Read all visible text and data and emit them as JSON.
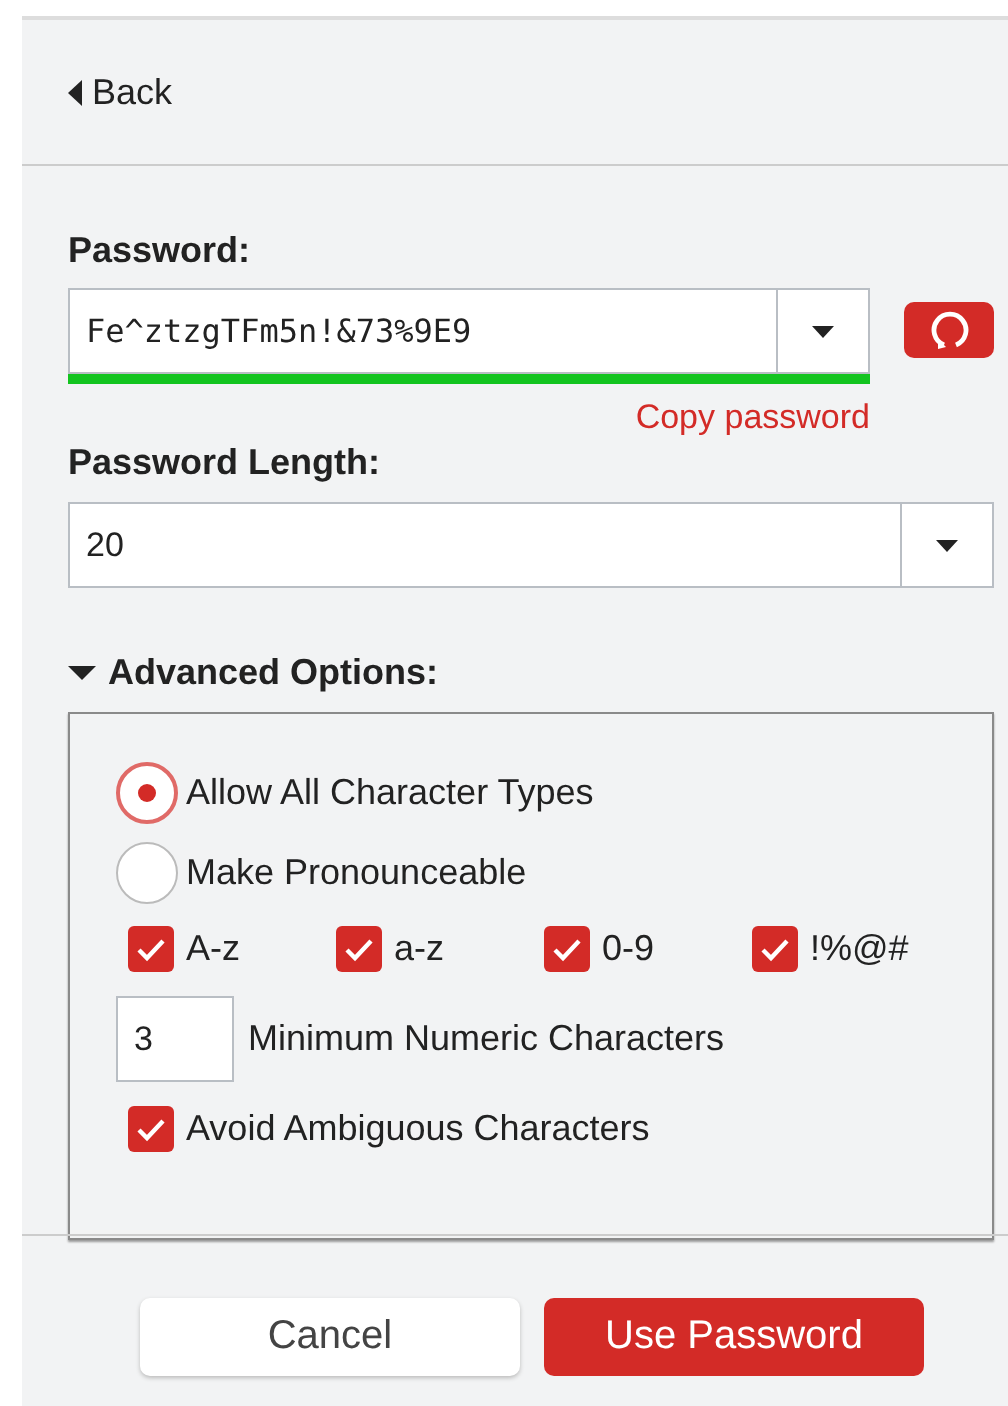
{
  "back": {
    "label": "Back"
  },
  "password": {
    "label": "Password:",
    "value": "Fe^ztzgTFm5n!&73%9E9",
    "strength": {
      "level": 1.0,
      "color": "#13c41f"
    },
    "copy_link": "Copy password"
  },
  "length": {
    "label": "Password Length:",
    "value": "20"
  },
  "advanced": {
    "label": "Advanced Options:",
    "expanded": true,
    "modes": [
      {
        "label": "Allow All Character Types",
        "selected": true
      },
      {
        "label": "Make Pronounceable",
        "selected": false
      }
    ],
    "char_types": [
      {
        "label": "A-z",
        "checked": true
      },
      {
        "label": "a-z",
        "checked": true
      },
      {
        "label": "0-9",
        "checked": true
      },
      {
        "label": "!%@#",
        "checked": true
      }
    ],
    "min_numeric": {
      "value": "3",
      "label": "Minimum Numeric Characters"
    },
    "avoid_ambiguous": {
      "label": "Avoid Ambiguous Characters",
      "checked": true
    }
  },
  "buttons": [
    {
      "label": "Cancel",
      "kind": "secondary"
    },
    {
      "label": "Use Password",
      "kind": "primary"
    }
  ]
}
